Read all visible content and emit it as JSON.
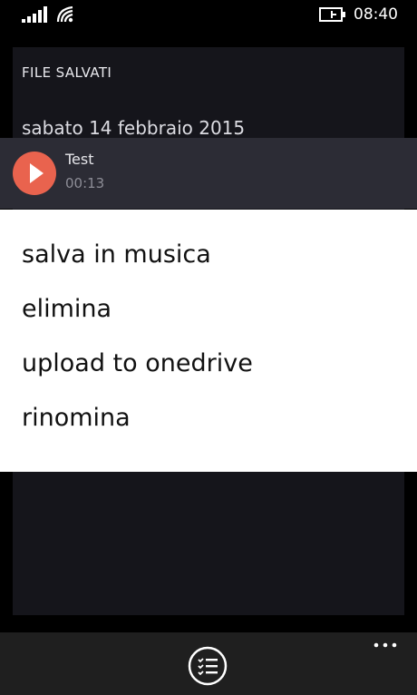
{
  "status_bar": {
    "time": "08:40"
  },
  "page": {
    "section_title": "FILE SALVATI",
    "date_header": "sabato 14 febbraio 2015"
  },
  "recording": {
    "title": "Test",
    "duration": "00:13"
  },
  "context_menu": {
    "items": [
      {
        "label": "salva in musica"
      },
      {
        "label": "elimina"
      },
      {
        "label": "upload to onedrive"
      },
      {
        "label": "rinomina"
      }
    ]
  },
  "colors": {
    "accent": "#e9634e",
    "menu_bg": "#ffffff",
    "row_bg": "#2c2c35"
  }
}
